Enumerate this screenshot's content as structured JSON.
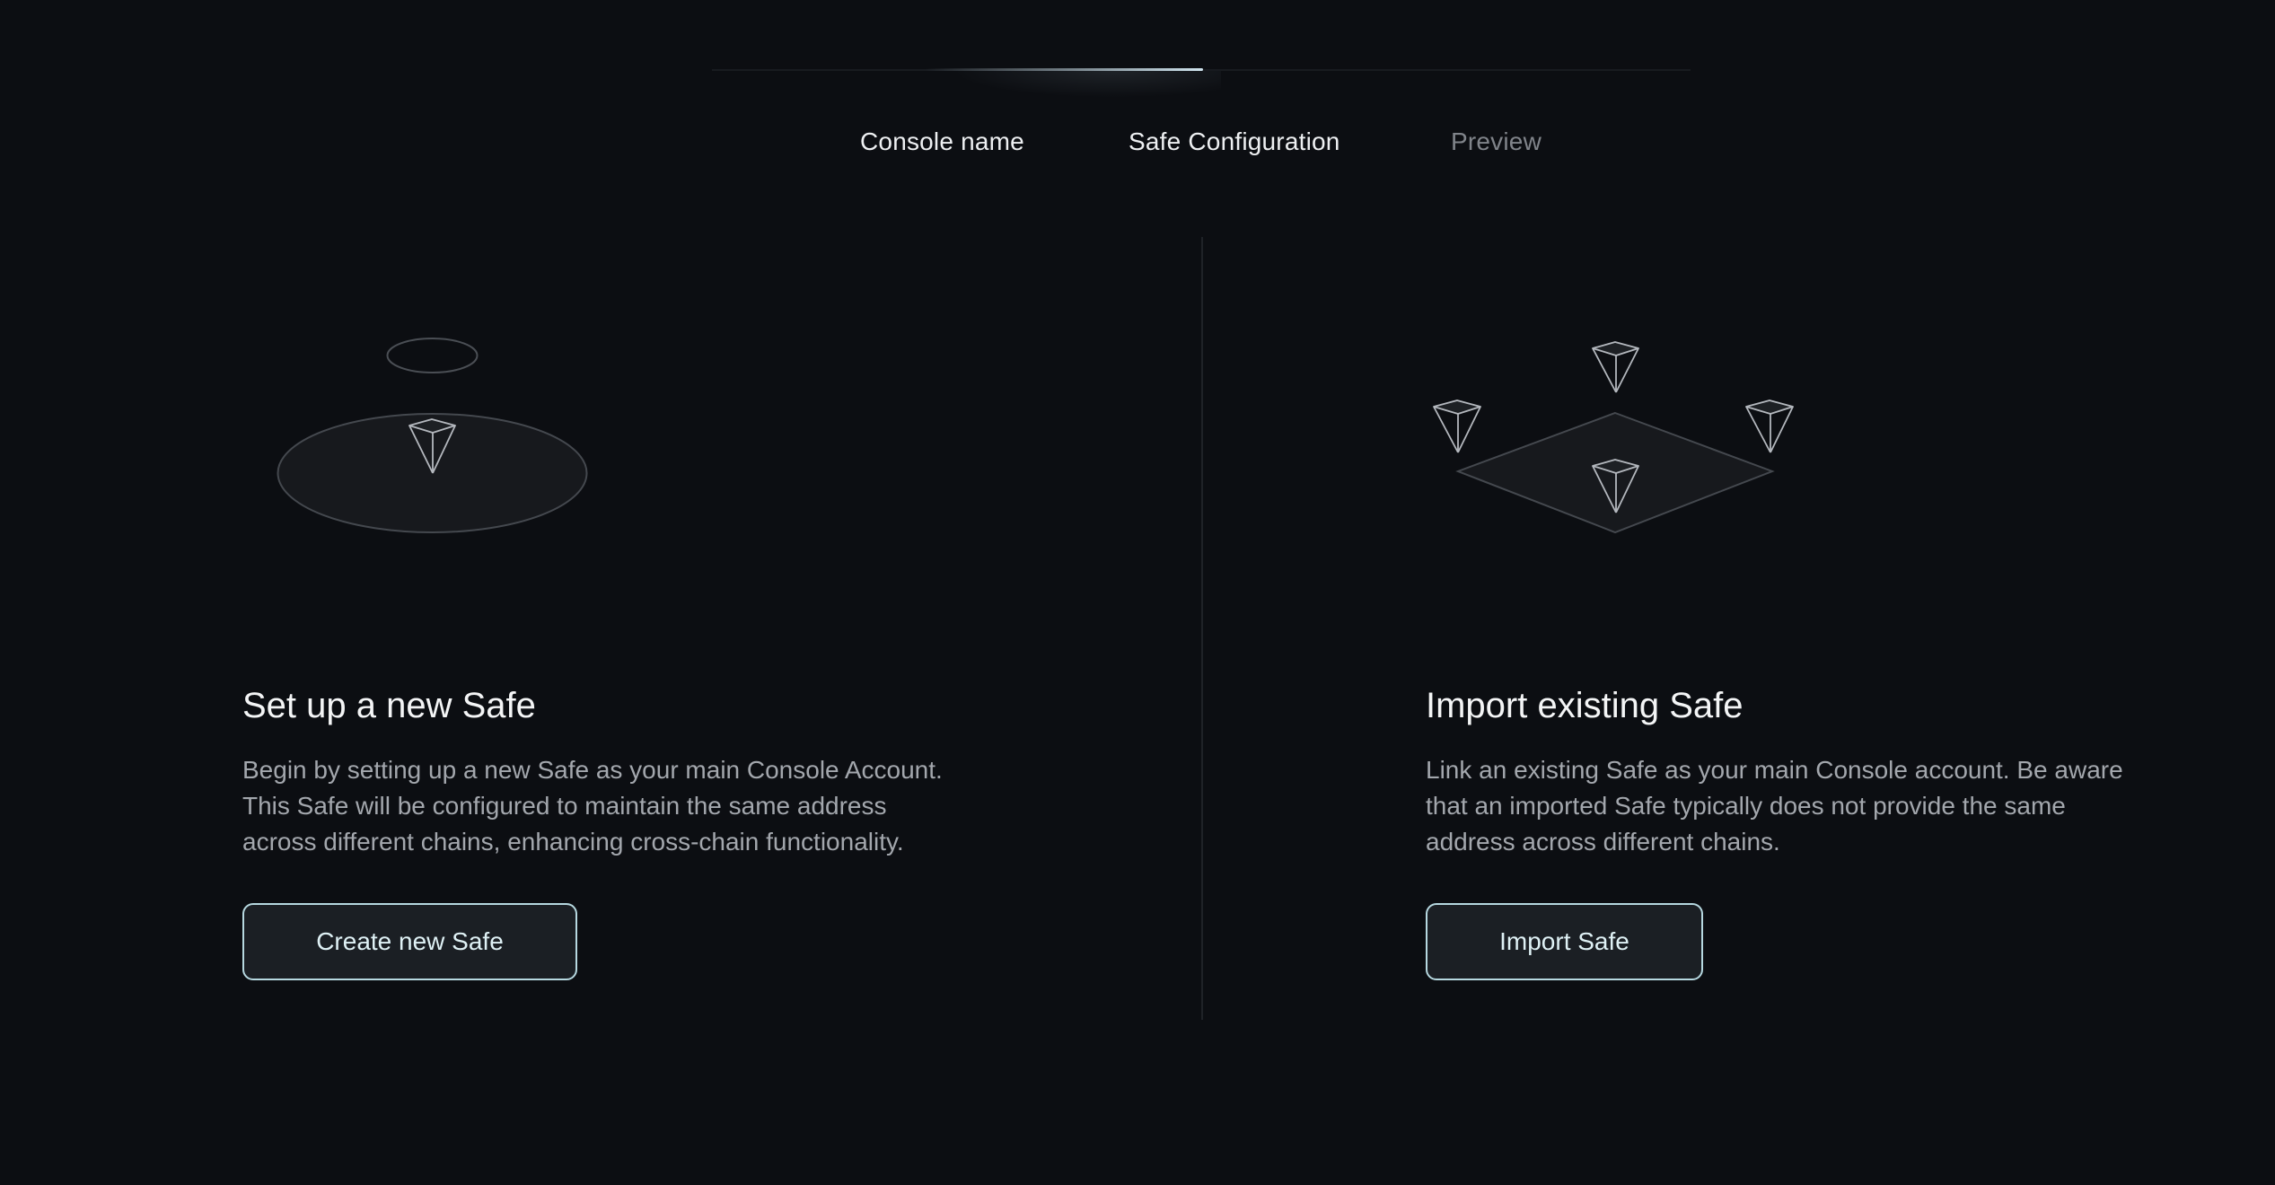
{
  "stepper": {
    "steps": [
      {
        "label": "Console name",
        "state": "done"
      },
      {
        "label": "Safe Configuration",
        "state": "active"
      },
      {
        "label": "Preview",
        "state": "future"
      }
    ]
  },
  "options": {
    "new_safe": {
      "title": "Set up a new Safe",
      "description_lines": [
        "Begin by setting up a new Safe as your main Console Account.",
        "This Safe will be configured to maintain the same address",
        "across different chains, enhancing cross-chain functionality."
      ],
      "button_label": "Create new Safe",
      "illustration_icon": "single-safe-illustration-icon"
    },
    "import_safe": {
      "title": "Import existing Safe",
      "description_lines": [
        "Link an existing Safe as your main Console account. Be aware",
        "that an imported Safe typically does not provide the same",
        "address across different chains."
      ],
      "button_label": "Import Safe",
      "illustration_icon": "multi-chain-safe-illustration-icon"
    }
  },
  "colors": {
    "background": "#0c0e12",
    "button_border": "#b6d8e0",
    "button_fill": "#1b1f24",
    "text_primary": "#f4f5f6",
    "text_secondary": "#a3a7ad",
    "text_muted": "#80848a",
    "divider": "#1f2227"
  }
}
